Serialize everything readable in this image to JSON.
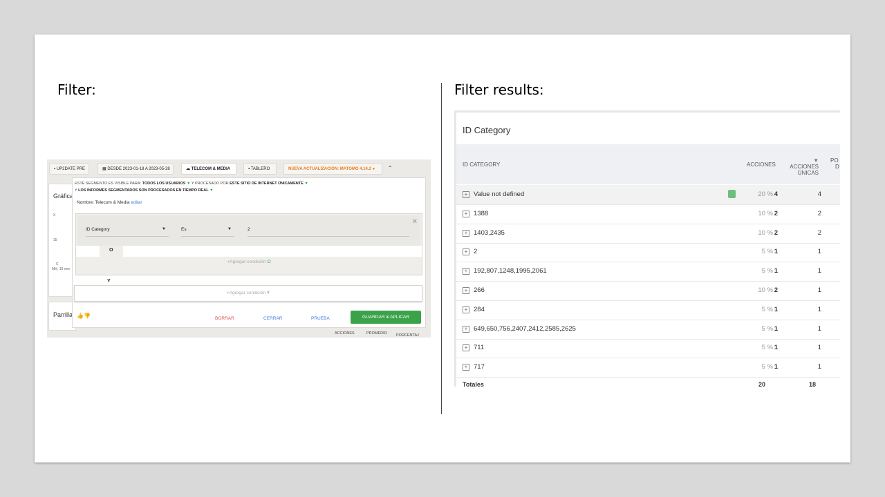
{
  "left_heading": "Filter:",
  "right_heading": "Filter results:",
  "filter_shot": {
    "toolbar": {
      "segment": "UP2DATE PRE",
      "date_range": "DESDE 2023-01-18 A 2023-05-28",
      "site": "TELECOM & MEDIA",
      "dashboard": "TABLERO",
      "update_notice": "NUEVA ACTUALIZACIÓN: MATOMO 4.14.2",
      "collapse_icon": "chevron-up-icon"
    },
    "background": {
      "graph_title": "Gráfica",
      "grid_title": "Parrilla",
      "axis_x": "X",
      "axis_15": "15",
      "axis_0": "C",
      "date_label": "Mié, 18 ene",
      "footer_cols": [
        "ACCIONES",
        "PROMEDIO",
        "PORCENTAJ"
      ]
    },
    "segment": {
      "visible_prefix": "ESTE SEGMENTO ES VISIBLE PARA:",
      "visible_value": "TODOS LOS USUARIOS",
      "processed_prefix": "Y PROCESADO POR",
      "processed_value": "ESTE SITIO DE INTERNET ÚNICAMENTE",
      "realtime_prefix": "Y",
      "realtime_value": "LOS INFORMES SEGMENTADOS SON PROCESADOS EN TIEMPO REAL",
      "name_label": "Nombre: Telecom & Media",
      "edit_link": "editar",
      "condition": {
        "dimension": "ID Category",
        "operator": "Es",
        "value": "2"
      },
      "or_label": "O",
      "add_or": "+Agregar condición",
      "add_or_suffix": "O",
      "and_label": "Y",
      "add_and": "+Agregar condición",
      "add_and_suffix": "Y",
      "buttons": {
        "delete": "BORRAR",
        "close": "CERRAR",
        "test": "PRUEBA",
        "save": "GUARDAR & APLICAR"
      },
      "colors": {
        "delete": "#d9534f",
        "link": "#3b7ddd",
        "save": "#3aa34a"
      }
    }
  },
  "results_shot": {
    "title": "ID Category",
    "headers": {
      "label": "ID CATEGORY",
      "actions": "ACCIONES",
      "unique_line1": "ACCIONES",
      "unique_line2": "ÚNICAS",
      "more_line1": "PO",
      "more_line2": "D"
    },
    "rows": [
      {
        "label": "Value not defined",
        "pct": "20 %",
        "actions": "4",
        "unique": "4"
      },
      {
        "label": "1388",
        "pct": "10 %",
        "actions": "2",
        "unique": "2"
      },
      {
        "label": "1403,2435",
        "pct": "10 %",
        "actions": "2",
        "unique": "2"
      },
      {
        "label": "2",
        "pct": "5 %",
        "actions": "1",
        "unique": "1"
      },
      {
        "label": "192,807,1248,1995,2061",
        "pct": "5 %",
        "actions": "1",
        "unique": "1"
      },
      {
        "label": "266",
        "pct": "10 %",
        "actions": "2",
        "unique": "1"
      },
      {
        "label": "284",
        "pct": "5 %",
        "actions": "1",
        "unique": "1"
      },
      {
        "label": "649,650,756,2407,2412,2585,2625",
        "pct": "5 %",
        "actions": "1",
        "unique": "1"
      },
      {
        "label": "711",
        "pct": "5 %",
        "actions": "1",
        "unique": "1"
      },
      {
        "label": "717",
        "pct": "5 %",
        "actions": "1",
        "unique": "1"
      }
    ],
    "totals": {
      "label": "Totales",
      "actions": "20",
      "unique": "18"
    }
  }
}
